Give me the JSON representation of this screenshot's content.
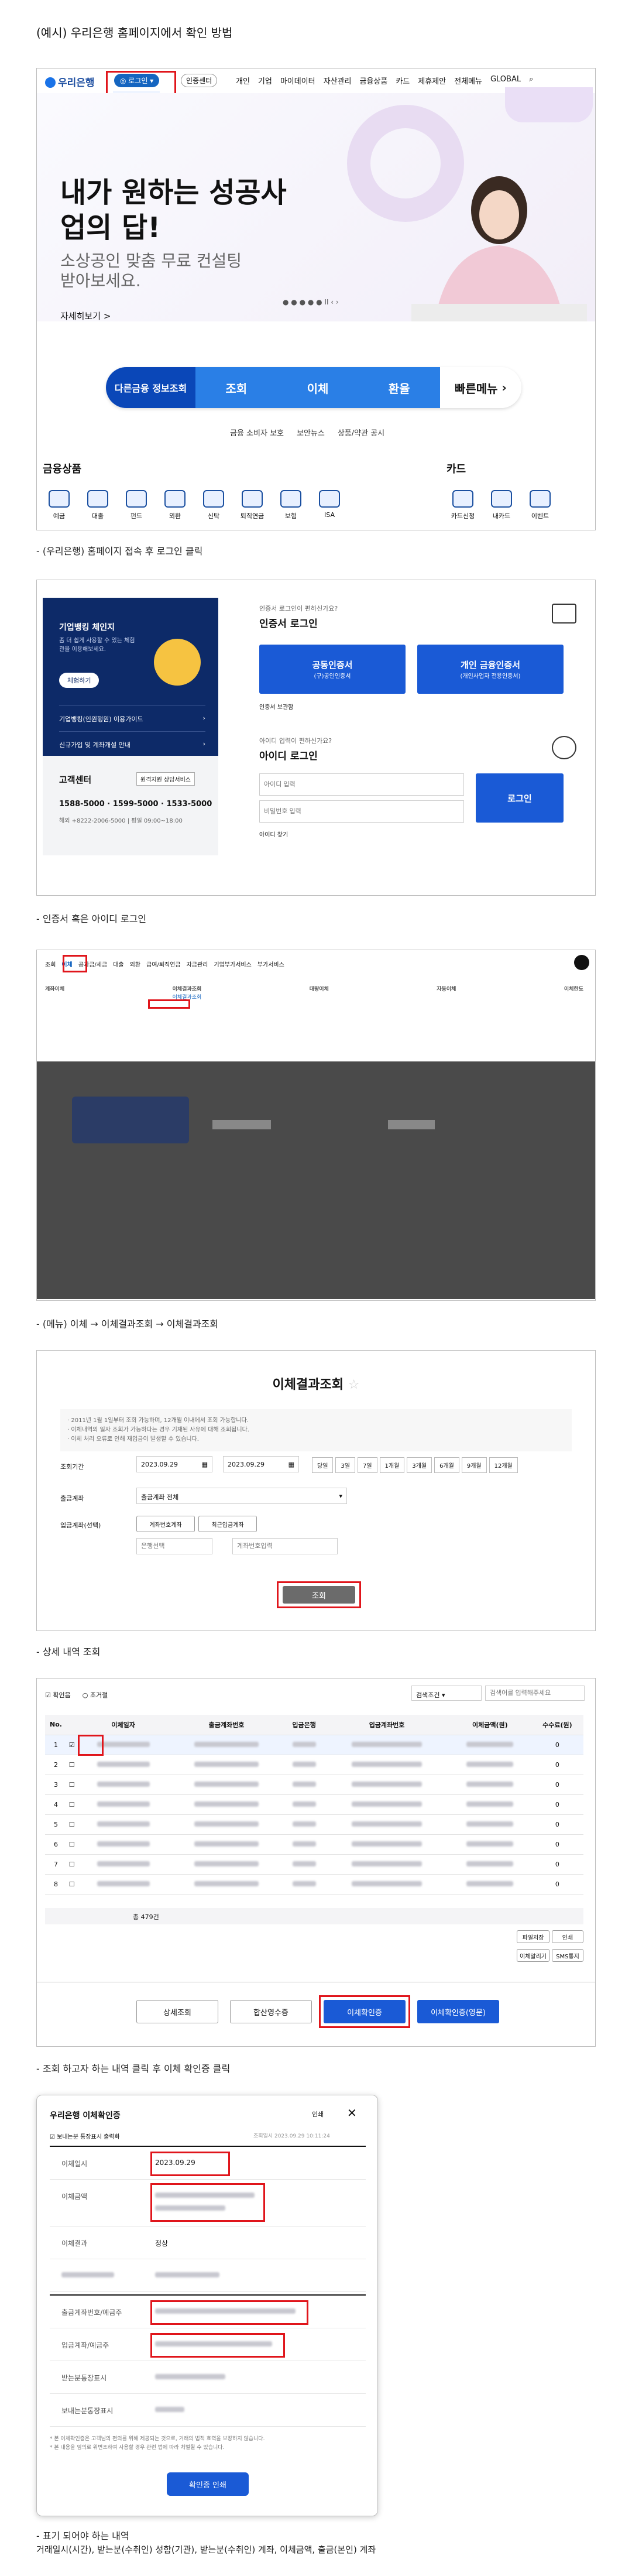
{
  "doc": {
    "title": "(예시) 우리은행 홈페이지에서 확인 방법",
    "cap1": "- (우리은행) 홈페이지 접속 후 로그인 클릭",
    "cap2": "- 인증서 혹은 아이디 로그인",
    "cap3": "- (메뉴) 이체 → 이체결과조회 → 이체결과조회",
    "cap4": "- 상세 내역 조회",
    "cap5": "- 조회 하고자 하는 내역 클릭 후 이체 확인증 클릭",
    "cap6": "- 표기 되어야 하는 내역",
    "cap6b": "거래일시(시간),  받는분(수취인) 성함(기관),  받는분(수취인) 계좌,  이체금액,  출금(본인) 계좌"
  },
  "home": {
    "logo": "우리은행",
    "login": "로그인",
    "cert": "인증센터",
    "login_dd": [
      "개인",
      "기업"
    ],
    "nav": [
      "개인",
      "기업",
      "마이데이터",
      "자산관리",
      "금융상품",
      "카드",
      "제휴제안",
      "전체메뉴",
      "GLOBAL"
    ],
    "hero_title": "내가 원하는 성공사업의 답!",
    "hero_sub": "소상공인 맞춤 무료 컨설팅 받아보세요.",
    "hero_more": "자세히보기 >",
    "quick": [
      "다른금융 정보조회",
      "조회",
      "이체",
      "환율",
      "빠른메뉴"
    ],
    "links": [
      "금융 소비자 보호",
      "보안뉴스",
      "상품/약관 공시"
    ],
    "sec1": "금융상품",
    "sec2": "카드",
    "products": [
      "예금",
      "대출",
      "펀드",
      "외환",
      "신탁",
      "퇴직연금",
      "보험",
      "ISA"
    ],
    "cards": [
      "카드신청",
      "내카드",
      "이벤트"
    ]
  },
  "login": {
    "promo": "기업뱅킹 체인지",
    "promo_sub": "좀 더 쉽게 사용할 수 있는 체험관을 이용해보세요.",
    "promo_btn": "체험하기",
    "menu1": "기업뱅킹(인원행원) 이용가이드",
    "menu2": "신규가입 및 계좌개설 안내",
    "center": "고객센터",
    "center_badge": "원격지원 상담서비스",
    "phones": "1588-5000  ·  1599-5000  ·  1533-5000",
    "hours": "해외 +8222-2006-5000 | 평일 09:00~18:00",
    "cert_q": "인증서 로그인이 편하신가요?",
    "cert_title": "인증서 로그인",
    "btn_joint": "공동인증서",
    "btn_joint_sub": "(구)공인인증서",
    "btn_personal": "개인 금융인증서",
    "btn_personal_sub": "(개인사업자 전용인증서)",
    "cert_guide": "인증서 보관함",
    "id_q": "아이디 입력이 편하신가요?",
    "id_title": "아이디 로그인",
    "id_ph": "아이디 입력",
    "pw_ph": "비밀번호 입력",
    "login_btn": "로그인",
    "id_find": "아이디 찾기"
  },
  "menu": {
    "top": [
      "조회",
      "이체",
      "공과금/세금",
      "대출",
      "외환",
      "급여/퇴직연금",
      "자금관리",
      "기업부가서비스",
      "부가서비스"
    ],
    "cols": [
      "계좌이체",
      "이체결과조회",
      "대량이체",
      "자동이체",
      "이체한도"
    ],
    "highlight": "이체결과조회"
  },
  "transfer": {
    "title": "이체결과조회",
    "notes": [
      "· 2011년 1월 1일부터 조회 가능하며, 12개월 이내에서 조회 가능합니다.",
      "· 이체내역의 일자 조회가 가능하다는 경우 기재된 사유에 대해 조회됩니다.",
      "· 이체 처리 오류로 인해 재입금이 발생할 수 있습니다."
    ],
    "period_label": "조회기간",
    "date_from": "2023.09.29",
    "date_to": "2023.09.29",
    "periods": [
      "당일",
      "3일",
      "7일",
      "1개월",
      "3개월",
      "6개월",
      "9개월",
      "12개월"
    ],
    "acct_label": "출금계좌",
    "acct_val": "출금계좌 전체",
    "in_label": "입금계좌(선택)",
    "in_btn1": "계좌번호계좌",
    "in_btn2": "최근입금계좌",
    "bank_ph": "은행선택",
    "acct_ph": "계좌번호입력",
    "search": "조회"
  },
  "detail": {
    "f1": "확인음",
    "f2": "조거절",
    "filter": "검색조건",
    "search_ph": "검색어를 입력해주세요",
    "cols": [
      "No.",
      "",
      "이체일자",
      "출금계좌번호",
      "입금은행",
      "입금계좌번호",
      "이체금액(원)",
      "수수료(원)"
    ],
    "rows": [
      "1",
      "2",
      "3",
      "4",
      "5",
      "6",
      "7",
      "8"
    ],
    "total": "총 479건",
    "btn_excel": "파일저장",
    "btn_print": "인쇄",
    "btn_sms1": "이체알리기",
    "btn_sms2": "SMS통지",
    "btns": [
      "상세조회",
      "합산영수증",
      "이체확인증",
      "이체확인증(영문)"
    ]
  },
  "modal": {
    "title": "우리은행 이체확인증",
    "print": "인쇄",
    "chk": "보내는분 통장표시 출력화",
    "issued": "조회일시 2023.09.29 10:11:24",
    "labels": [
      "이체일시",
      "이체금액",
      "이체결과",
      "",
      "출금계좌번호/예금주",
      "입금계좌/예금주",
      "받는분통장표시",
      "보내는분통장표시"
    ],
    "date": "2023.09.29",
    "status": "정상",
    "notes": [
      "* 본 이체확인증은 고객님의 편의를 위해 제공되는 것으로, 거래의 법적 효력을 보장하지 않습니다.",
      "* 본 내용을 임의로 위변조하여 사용할 경우 관련 법에 따라 처벌될 수 있습니다."
    ],
    "btn": "확인증 인쇄"
  }
}
